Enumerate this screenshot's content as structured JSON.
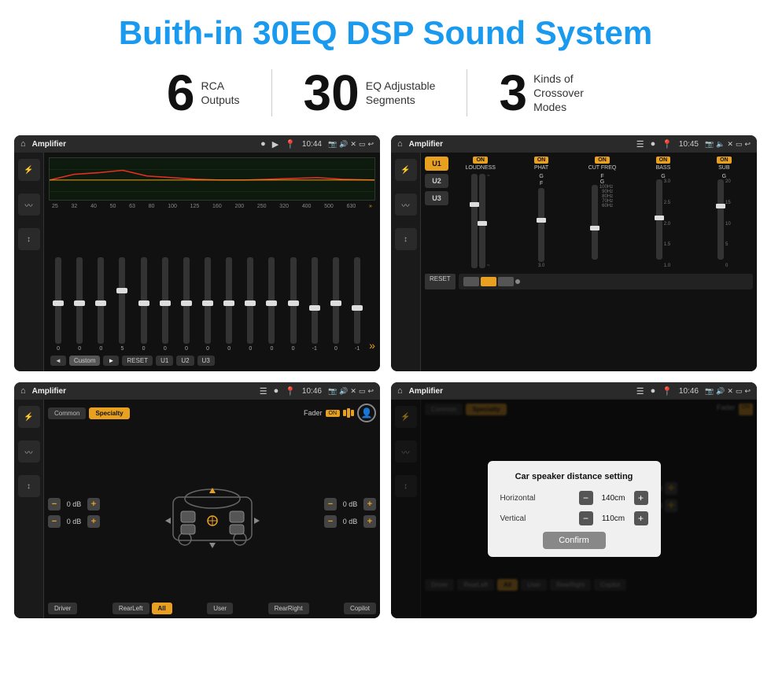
{
  "header": {
    "title": "Buith-in 30EQ DSP Sound System"
  },
  "stats": [
    {
      "number": "6",
      "text_line1": "RCA",
      "text_line2": "Outputs"
    },
    {
      "number": "30",
      "text_line1": "EQ Adjustable",
      "text_line2": "Segments"
    },
    {
      "number": "3",
      "text_line1": "Kinds of",
      "text_line2": "Crossover Modes"
    }
  ],
  "screens": [
    {
      "id": "screen1",
      "topbar": {
        "title": "Amplifier",
        "time": "10:44"
      },
      "type": "eq"
    },
    {
      "id": "screen2",
      "topbar": {
        "title": "Amplifier",
        "time": "10:45"
      },
      "type": "crossover"
    },
    {
      "id": "screen3",
      "topbar": {
        "title": "Amplifier",
        "time": "10:46"
      },
      "type": "specialty"
    },
    {
      "id": "screen4",
      "topbar": {
        "title": "Amplifier",
        "time": "10:46"
      },
      "type": "dialog"
    }
  ],
  "eq": {
    "freqs": [
      "25",
      "32",
      "40",
      "50",
      "63",
      "80",
      "100",
      "125",
      "160",
      "200",
      "250",
      "320",
      "400",
      "500",
      "630"
    ],
    "values": [
      "0",
      "0",
      "0",
      "5",
      "0",
      "0",
      "0",
      "0",
      "0",
      "0",
      "0",
      "0",
      "-1",
      "0",
      "-1"
    ],
    "buttons": [
      "◄",
      "Custom",
      "►",
      "RESET",
      "U1",
      "U2",
      "U3"
    ]
  },
  "crossover": {
    "presets": [
      "U1",
      "U2",
      "U3"
    ],
    "channels": [
      {
        "name": "LOUDNESS",
        "on": true
      },
      {
        "name": "PHAT",
        "on": true
      },
      {
        "name": "CUT FREQ",
        "on": true
      },
      {
        "name": "BASS",
        "on": true
      },
      {
        "name": "SUB",
        "on": true
      }
    ],
    "reset": "RESET"
  },
  "specialty": {
    "tabs": [
      "Common",
      "Specialty"
    ],
    "fader_label": "Fader",
    "fader_on": "ON",
    "db_values": [
      "0 dB",
      "0 dB",
      "0 dB",
      "0 dB"
    ],
    "positions": [
      "Driver",
      "RearLeft",
      "All",
      "User",
      "RearRight",
      "Copilot"
    ]
  },
  "dialog": {
    "title": "Car speaker distance setting",
    "horizontal_label": "Horizontal",
    "horizontal_value": "140cm",
    "vertical_label": "Vertical",
    "vertical_value": "110cm",
    "confirm_label": "Confirm"
  }
}
